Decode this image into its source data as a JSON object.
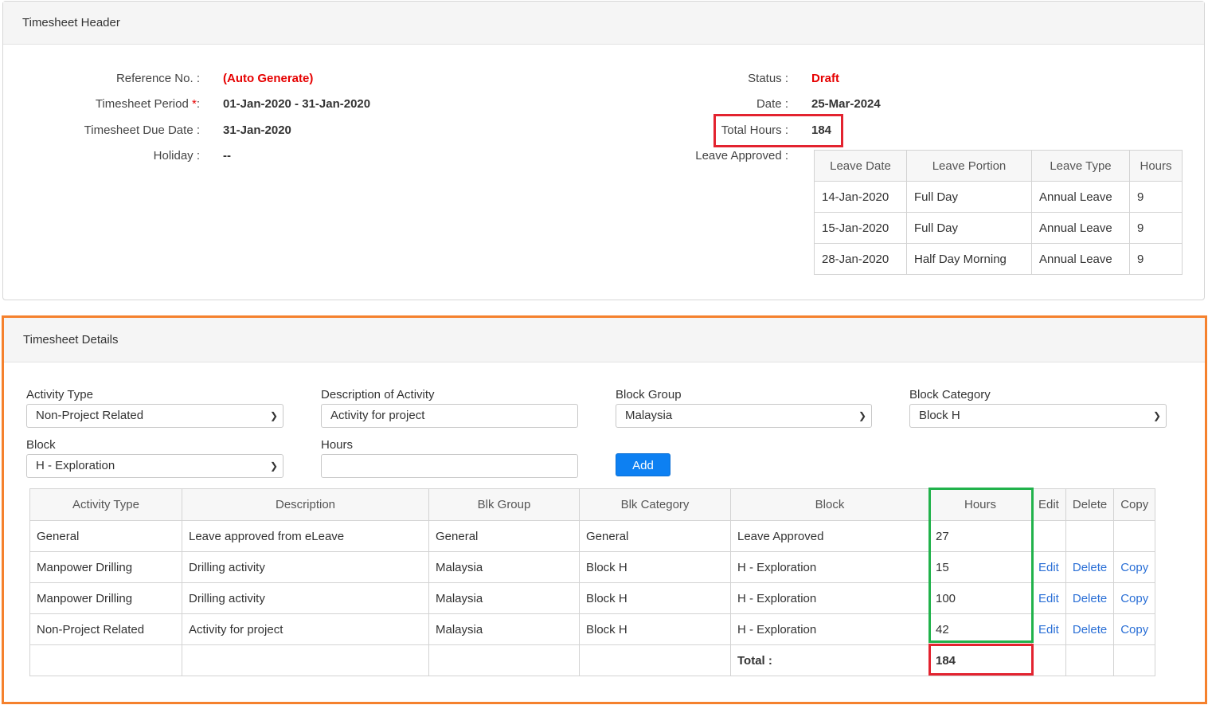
{
  "header_panel": {
    "title": "Timesheet Header",
    "reference_label": "Reference No. :",
    "reference_value": "(Auto Generate)",
    "period_label": "Timesheet Period",
    "period_req": "*",
    "period_colon": ":",
    "period_value": "01-Jan-2020 - 31-Jan-2020",
    "due_label": "Timesheet Due Date :",
    "due_value": "31-Jan-2020",
    "holiday_label": "Holiday :",
    "holiday_value": "--",
    "status_label": "Status :",
    "status_value": "Draft",
    "date_label": "Date :",
    "date_value": "25-Mar-2024",
    "total_label": "Total Hours :",
    "total_value": "184",
    "leave_label": "Leave Approved :",
    "leave_table": {
      "headers": [
        "Leave Date",
        "Leave Portion",
        "Leave Type",
        "Hours"
      ],
      "rows": [
        [
          "14-Jan-2020",
          "Full Day",
          "Annual Leave",
          "9"
        ],
        [
          "15-Jan-2020",
          "Full Day",
          "Annual Leave",
          "9"
        ],
        [
          "28-Jan-2020",
          "Half Day Morning",
          "Annual Leave",
          "9"
        ]
      ]
    }
  },
  "details_panel": {
    "title": "Timesheet Details",
    "form": {
      "activity_type_label": "Activity Type",
      "activity_type_value": "Non-Project Related",
      "description_label": "Description of Activity",
      "description_value": "Activity for project",
      "block_group_label": "Block Group",
      "block_group_value": "Malaysia",
      "block_category_label": "Block Category",
      "block_category_value": "Block H",
      "block_label": "Block",
      "block_value": "H - Exploration",
      "hours_label": "Hours",
      "hours_value": "",
      "add_button": "Add"
    },
    "table": {
      "headers": [
        "Activity Type",
        "Description",
        "Blk Group",
        "Blk Category",
        "Block",
        "Hours",
        "Edit",
        "Delete",
        "Copy"
      ],
      "rows": [
        {
          "activity": "General",
          "description": "Leave approved from eLeave",
          "blk_group": "General",
          "blk_category": "General",
          "block": "Leave Approved",
          "hours": "27",
          "edit": "",
          "delete": "",
          "copy": ""
        },
        {
          "activity": "Manpower Drilling",
          "description": "Drilling activity",
          "blk_group": "Malaysia",
          "blk_category": "Block H",
          "block": "H - Exploration",
          "hours": "15",
          "edit": "Edit",
          "delete": "Delete",
          "copy": "Copy"
        },
        {
          "activity": "Manpower Drilling",
          "description": "Drilling activity",
          "blk_group": "Malaysia",
          "blk_category": "Block H",
          "block": "H - Exploration",
          "hours": "100",
          "edit": "Edit",
          "delete": "Delete",
          "copy": "Copy"
        },
        {
          "activity": "Non-Project Related",
          "description": "Activity for project",
          "blk_group": "Malaysia",
          "blk_category": "Block H",
          "block": "H - Exploration",
          "hours": "42",
          "edit": "Edit",
          "delete": "Delete",
          "copy": "Copy"
        }
      ],
      "total_label": "Total :",
      "total_value": "184"
    }
  },
  "colors": {
    "draft_red": "#e60000",
    "highlight_red": "#e3232f",
    "highlight_green": "#21b24b",
    "highlight_orange": "#f5812d",
    "button_blue": "#0d80f2",
    "link_blue": "#2a6fd6"
  },
  "icons": [
    "chevron-down-icon"
  ]
}
